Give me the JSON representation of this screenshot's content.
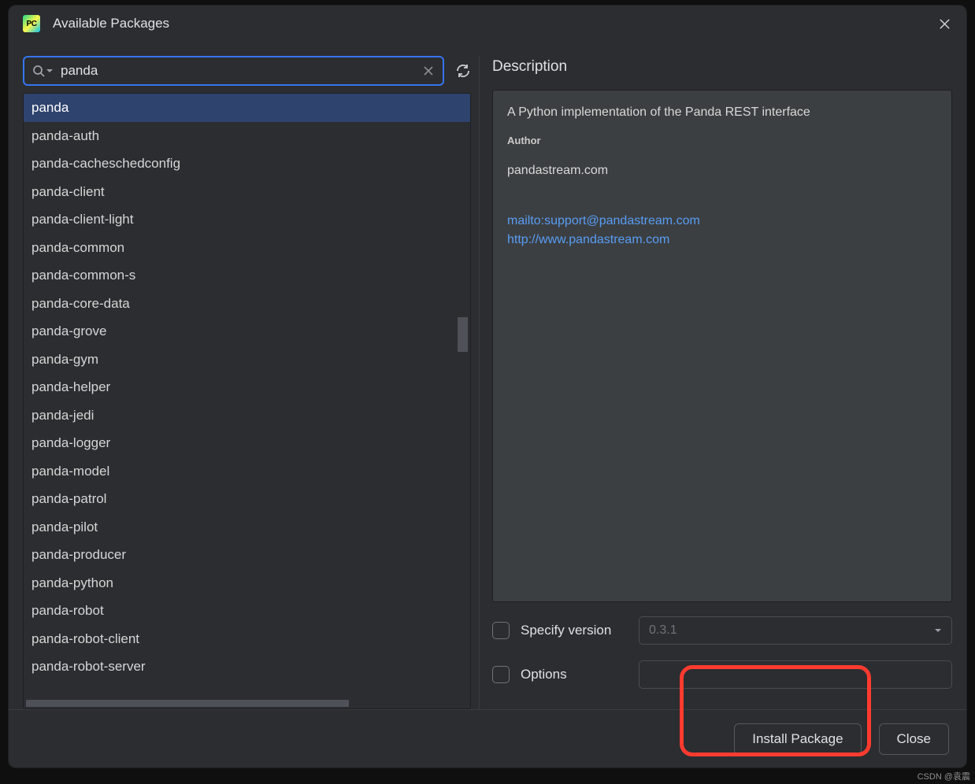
{
  "window": {
    "title": "Available Packages"
  },
  "search": {
    "value": "panda",
    "placeholder": ""
  },
  "packages": [
    "panda",
    "panda-auth",
    "panda-cacheschedconfig",
    "panda-client",
    "panda-client-light",
    "panda-common",
    "panda-common-s",
    "panda-core-data",
    "panda-grove",
    "panda-gym",
    "panda-helper",
    "panda-jedi",
    "panda-logger",
    "panda-model",
    "panda-patrol",
    "panda-pilot",
    "panda-producer",
    "panda-python",
    "panda-robot",
    "panda-robot-client",
    "panda-robot-server"
  ],
  "selected_index": 0,
  "description": {
    "heading": "Description",
    "text": "A Python implementation of the Panda REST interface",
    "author_label": "Author",
    "author_name": "pandastream.com",
    "links": [
      "mailto:support@pandastream.com",
      "http://www.pandastream.com"
    ]
  },
  "controls": {
    "specify_version_label": "Specify version",
    "specify_version_value": "0.3.1",
    "options_label": "Options",
    "options_value": ""
  },
  "buttons": {
    "install": "Install Package",
    "close": "Close"
  },
  "watermark": "CSDN @袁震"
}
